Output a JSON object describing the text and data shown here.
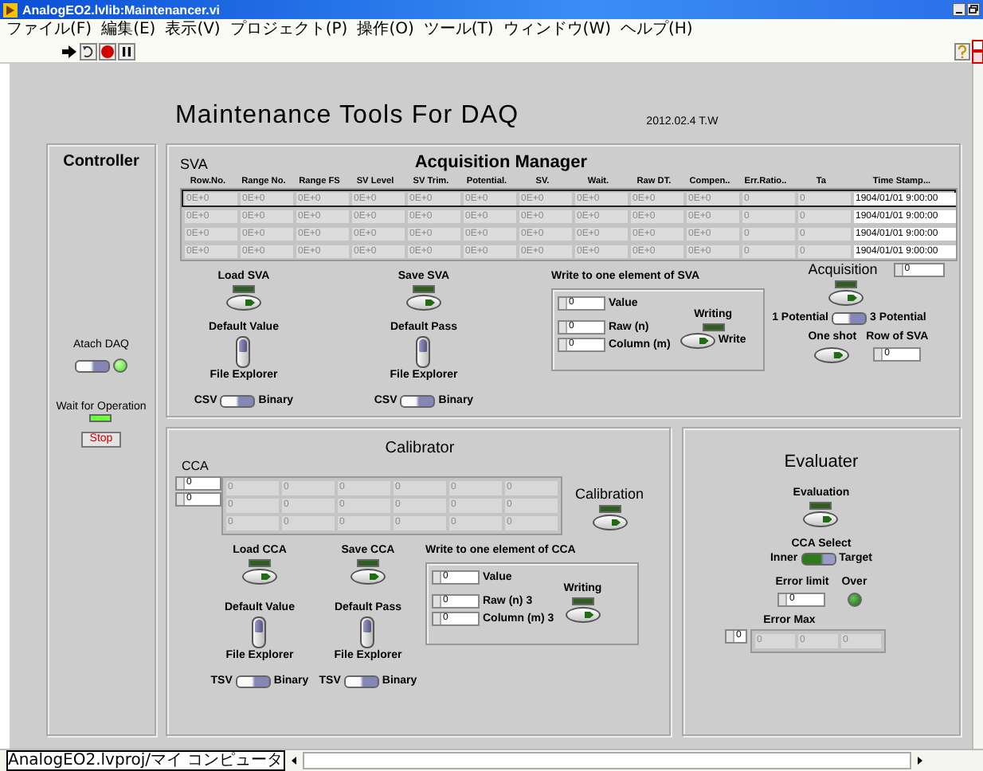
{
  "window": {
    "title": "AnalogEO2.lvlib:Maintenancer.vi"
  },
  "menu": [
    "ファイル(F)",
    "編集(E)",
    "表示(V)",
    "プロジェクト(P)",
    "操作(O)",
    "ツール(T)",
    "ウィンドウ(W)",
    "ヘルプ(H)"
  ],
  "heading": {
    "title": "Maintenance Tools For DAQ",
    "note": "2012.02.4 T.W"
  },
  "controller": {
    "title": "Controller",
    "attach": {
      "label": "Atach DAQ",
      "switch_on": false,
      "led_on": true
    },
    "wait": {
      "label": "Wait for Operation",
      "led_on": true
    },
    "stop": "Stop"
  },
  "acquisition": {
    "label": "SVA",
    "title": "Acquisition Manager",
    "columns": [
      "Row.No.",
      "Range No.",
      "Range FS",
      "SV Level",
      "SV Trim.",
      "Potential.",
      "SV.",
      "Wait.",
      "Raw DT.",
      "Compen..",
      "Err.Ratio..",
      "Ta",
      "Time Stamp..."
    ],
    "rows": [
      {
        "selected": true,
        "cells": [
          "0E+0",
          "0E+0",
          "0E+0",
          "0E+0",
          "0E+0",
          "0E+0",
          "0E+0",
          "0E+0",
          "0E+0",
          "0E+0",
          "0",
          "0",
          "1904/01/01 9:00:00"
        ]
      },
      {
        "selected": false,
        "cells": [
          "0E+0",
          "0E+0",
          "0E+0",
          "0E+0",
          "0E+0",
          "0E+0",
          "0E+0",
          "0E+0",
          "0E+0",
          "0E+0",
          "0",
          "0",
          "1904/01/01 9:00:00"
        ]
      },
      {
        "selected": false,
        "cells": [
          "0E+0",
          "0E+0",
          "0E+0",
          "0E+0",
          "0E+0",
          "0E+0",
          "0E+0",
          "0E+0",
          "0E+0",
          "0E+0",
          "0",
          "0",
          "1904/01/01 9:00:00"
        ]
      },
      {
        "selected": false,
        "cells": [
          "0E+0",
          "0E+0",
          "0E+0",
          "0E+0",
          "0E+0",
          "0E+0",
          "0E+0",
          "0E+0",
          "0E+0",
          "0E+0",
          "0",
          "0",
          "1904/01/01 9:00:00"
        ]
      }
    ],
    "file_controls": [
      {
        "button": "Load SVA",
        "led_on": false,
        "toggle_on": false,
        "default": "Default Value",
        "explorer": "File Explorer",
        "format_left": "CSV",
        "format_right": "Binary",
        "format_on": false
      },
      {
        "button": "Save SVA",
        "led_on": false,
        "toggle_on": false,
        "default": "Default Pass",
        "explorer": "File Explorer",
        "format_left": "CSV",
        "format_right": "Binary",
        "format_on": false
      }
    ],
    "write": {
      "title": "Write to one element of SVA",
      "fields": [
        {
          "value": "0",
          "label": "Value"
        },
        {
          "value": "0",
          "label": "Raw (n)"
        },
        {
          "value": "0",
          "label": "Column (m)"
        }
      ],
      "led_label": "Writing",
      "led_on": false,
      "button": "Write"
    },
    "run": {
      "label": "Acquisition",
      "count": "0",
      "led_on": false,
      "mode_left": "1 Potential",
      "mode_right": "3 Potential",
      "mode_on": false,
      "oneshot": "One shot",
      "row_label": "Row of SVA",
      "row_value": "0"
    }
  },
  "calibrator": {
    "title": "Calibrator",
    "array_label": "CCA",
    "indices": [
      "0",
      "0"
    ],
    "grid": [
      [
        "0",
        "0",
        "0",
        "0",
        "0",
        "0"
      ],
      [
        "0",
        "0",
        "0",
        "0",
        "0",
        "0"
      ],
      [
        "0",
        "0",
        "0",
        "0",
        "0",
        "0"
      ]
    ],
    "action": {
      "label": "Calibration",
      "led_on": false
    },
    "file_controls": [
      {
        "button": "Load CCA",
        "led_on": false,
        "toggle_on": false,
        "default": "Default Value",
        "explorer": "File Explorer",
        "format_left": "TSV",
        "format_right": "Binary",
        "format_on": false
      },
      {
        "button": "Save CCA",
        "led_on": false,
        "toggle_on": false,
        "default": "Default Pass",
        "explorer": "File Explorer",
        "format_left": "TSV",
        "format_right": "Binary",
        "format_on": false
      }
    ],
    "write": {
      "title": "Write to one element of CCA",
      "fields": [
        {
          "value": "0",
          "label": "Value"
        },
        {
          "value": "0",
          "label": "Raw (n) 3"
        },
        {
          "value": "0",
          "label": "Column (m) 3"
        }
      ],
      "led_label": "Writing",
      "led_on": false
    }
  },
  "evaluator": {
    "title": "Evaluater",
    "action": {
      "label": "Evaluation",
      "led_on": false
    },
    "select": {
      "label": "CCA Select",
      "left": "Inner",
      "right": "Target",
      "on": true
    },
    "limit": {
      "label": "Error limit",
      "value": "0"
    },
    "over": {
      "label": "Over",
      "led_on": false
    },
    "max": {
      "label": "Error Max",
      "index": "0",
      "values": [
        "0",
        "0",
        "0"
      ]
    }
  },
  "status_bar": {
    "path": "AnalogEO2.lvproj/マイ コンピュータ"
  }
}
